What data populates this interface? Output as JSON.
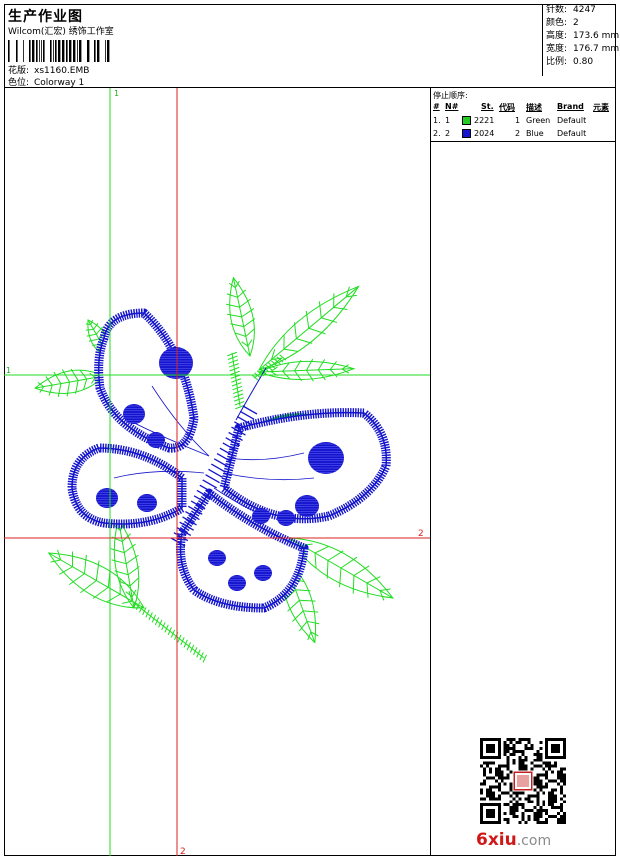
{
  "header": {
    "title": "生产作业图",
    "company": "Wilcom(汇宏) 绣饰工作室",
    "design_label": "花版:",
    "design_value": "xs1160.EMB",
    "colorway_label": "色位:",
    "colorway_value": "Colorway 1"
  },
  "stats": {
    "stitches_label": "针数:",
    "stitches_value": "4247",
    "colors_label": "颜色:",
    "colors_value": "2",
    "height_label": "高度:",
    "height_value": "173.6 mm",
    "width_label": "宽度:",
    "width_value": "176.7 mm",
    "ratio_label": "比例:",
    "ratio_value": "0.80"
  },
  "sequence": {
    "caption": "停止顺序:",
    "headers": [
      "#",
      "N#",
      "St.",
      "代码",
      "描述",
      "Brand",
      "元素"
    ],
    "rows": [
      {
        "idx": "1.",
        "n": "1",
        "code": "2221",
        "st": "1",
        "desc": "Green",
        "brand": "Default",
        "color": "#22cc22"
      },
      {
        "idx": "2.",
        "n": "2",
        "code": "2024",
        "st": "2",
        "desc": "Blue",
        "brand": "Default",
        "color": "#1414cc"
      }
    ]
  },
  "guides": {
    "green_top": "1",
    "green_left": "1",
    "red_right": "2",
    "red_bottom": "2",
    "green_color": "#22dd22",
    "red_color": "#dd2222"
  },
  "thread_colors": {
    "green": "#22dd22",
    "blue": "#1414cc"
  },
  "watermark": {
    "text": "6xiu",
    "suffix": ".com"
  }
}
